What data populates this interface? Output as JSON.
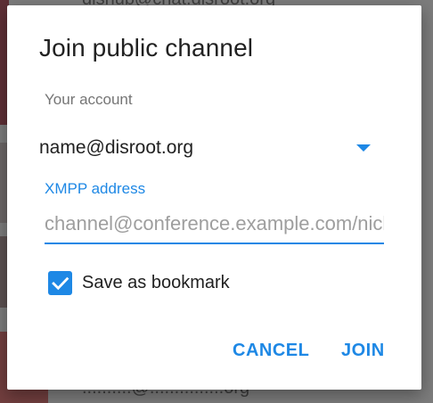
{
  "background": {
    "top_text": "disnub@chat.disroot.org",
    "bottom_text": "..........@...............org"
  },
  "dialog": {
    "title": "Join public channel",
    "account": {
      "label": "Your account",
      "selected": "name@disroot.org"
    },
    "xmpp": {
      "label": "XMPP address",
      "value": "",
      "placeholder": "channel@conference.example.com/nick"
    },
    "bookmark": {
      "label": "Save as bookmark",
      "checked": true
    },
    "buttons": {
      "cancel": "CANCEL",
      "join": "JOIN"
    }
  },
  "colors": {
    "accent": "#1e88e5",
    "title_text": "#212121",
    "secondary_text": "#757575",
    "hint_text": "#9e9e9e",
    "scrim": "#7c7c7c"
  },
  "icons": {
    "dropdown": "dropdown-arrow-icon",
    "checkbox": "check-icon"
  }
}
